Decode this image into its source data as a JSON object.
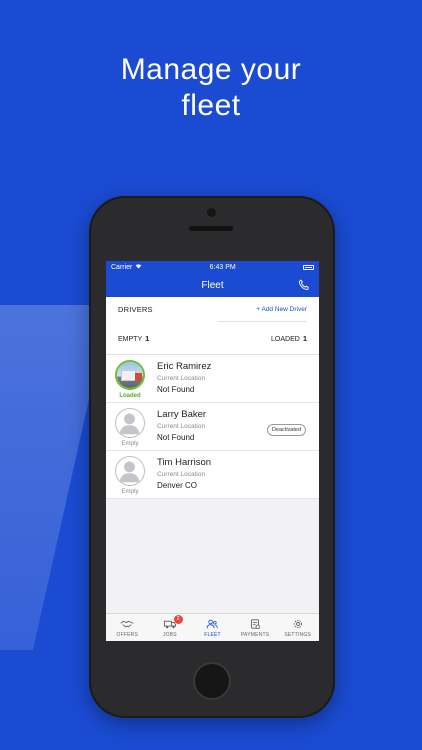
{
  "headline": {
    "line1": "Manage your",
    "line2": "fleet"
  },
  "status_bar": {
    "carrier": "Carrier",
    "time": "6:43 PM"
  },
  "nav": {
    "title": "Fleet"
  },
  "summary": {
    "drivers_label": "DRIVERS",
    "add_driver": "+ Add New Driver",
    "empty_label": "EMPTY",
    "empty_count": "1",
    "loaded_label": "LOADED",
    "loaded_count": "1"
  },
  "drivers": [
    {
      "name": "Eric Ramirez",
      "location_label": "Current Location",
      "location": "Not Found",
      "status": "Loaded"
    },
    {
      "name": "Larry Baker",
      "location_label": "Current Location",
      "location": "Not Found",
      "status": "Empty",
      "badge": "Deactivated"
    },
    {
      "name": "Tim Harrison",
      "location_label": "Current Location",
      "location": "Denver CO",
      "status": "Empty"
    }
  ],
  "tabs": [
    {
      "label": "OFFERS",
      "icon": "handshake-icon"
    },
    {
      "label": "JOBS",
      "icon": "truck-icon",
      "badge": "2"
    },
    {
      "label": "FLEET",
      "icon": "people-icon",
      "active": true
    },
    {
      "label": "PAYMENTS",
      "icon": "payments-icon"
    },
    {
      "label": "SETTINGS",
      "icon": "gear-icon"
    }
  ],
  "colors": {
    "brand": "#1a4bd2",
    "loaded": "#5aa92e",
    "badge": "#e8473c"
  }
}
